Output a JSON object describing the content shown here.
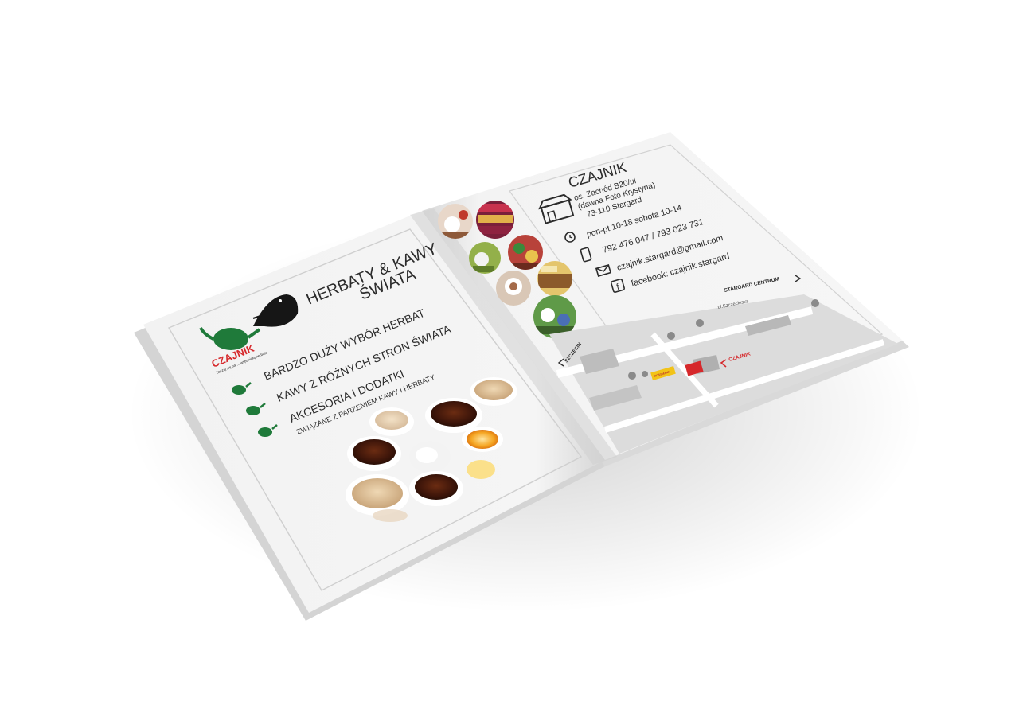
{
  "left_page": {
    "logo": {
      "brand_text": "CZAJNIK",
      "tagline": "Zaczaj się na ... wspaniałą herbatę",
      "icon": "teapot-with-bird-logo"
    },
    "headline_line1": "HERBATY & KAWY",
    "headline_line2": "ŚWIATA",
    "bullets": [
      {
        "text": "BARDZO DUŻY WYBÓR HERBAT",
        "icon": "teapot-bullet-icon"
      },
      {
        "text": "KAWY Z RÓŻNYCH STRON ŚWIATA",
        "icon": "teapot-bullet-icon"
      },
      {
        "text": "AKCESORIA I DODATKI",
        "icon": "teapot-bullet-icon"
      }
    ],
    "bullet3_sub": "ZWIĄZANE Z PARZENIEM KAWY I HERBATY",
    "photo": "tea-cups-photo"
  },
  "right_page": {
    "title": "CZAJNIK",
    "address_lines": [
      "os. Zachód B20/ul",
      "(dawna Foto Krystyna)",
      "73-110 Stargard"
    ],
    "hours": "pon-pt 10-18  sobota 10-14",
    "phone": "792 476 047 / 793 023 731",
    "email": "czajnik.stargard@gmail.com",
    "facebook": "facebook: czajnik stargard",
    "icons": {
      "shop": "shop-icon",
      "clock": "clock-icon",
      "phone": "phone-icon",
      "mail": "mail-icon",
      "facebook": "facebook-icon"
    },
    "photos": [
      "shop-photo",
      "shop-photo",
      "shop-photo",
      "shop-photo",
      "shop-photo",
      "shop-photo",
      "shop-photo"
    ],
    "map": {
      "label_centrum": "STARGARD CENTRUM",
      "label_street": "ul.Szczecińska",
      "label_szczecin": "SZCZECIN",
      "label_czajnik": "CZAJNIK",
      "label_rossmann": "ROSSMANN"
    }
  },
  "colors": {
    "brand_red": "#d6282b",
    "brand_green": "#1f7a3a",
    "page_bg": "#f4f4f4",
    "map_road": "#ffffff",
    "map_block": "#cfcfcf"
  }
}
